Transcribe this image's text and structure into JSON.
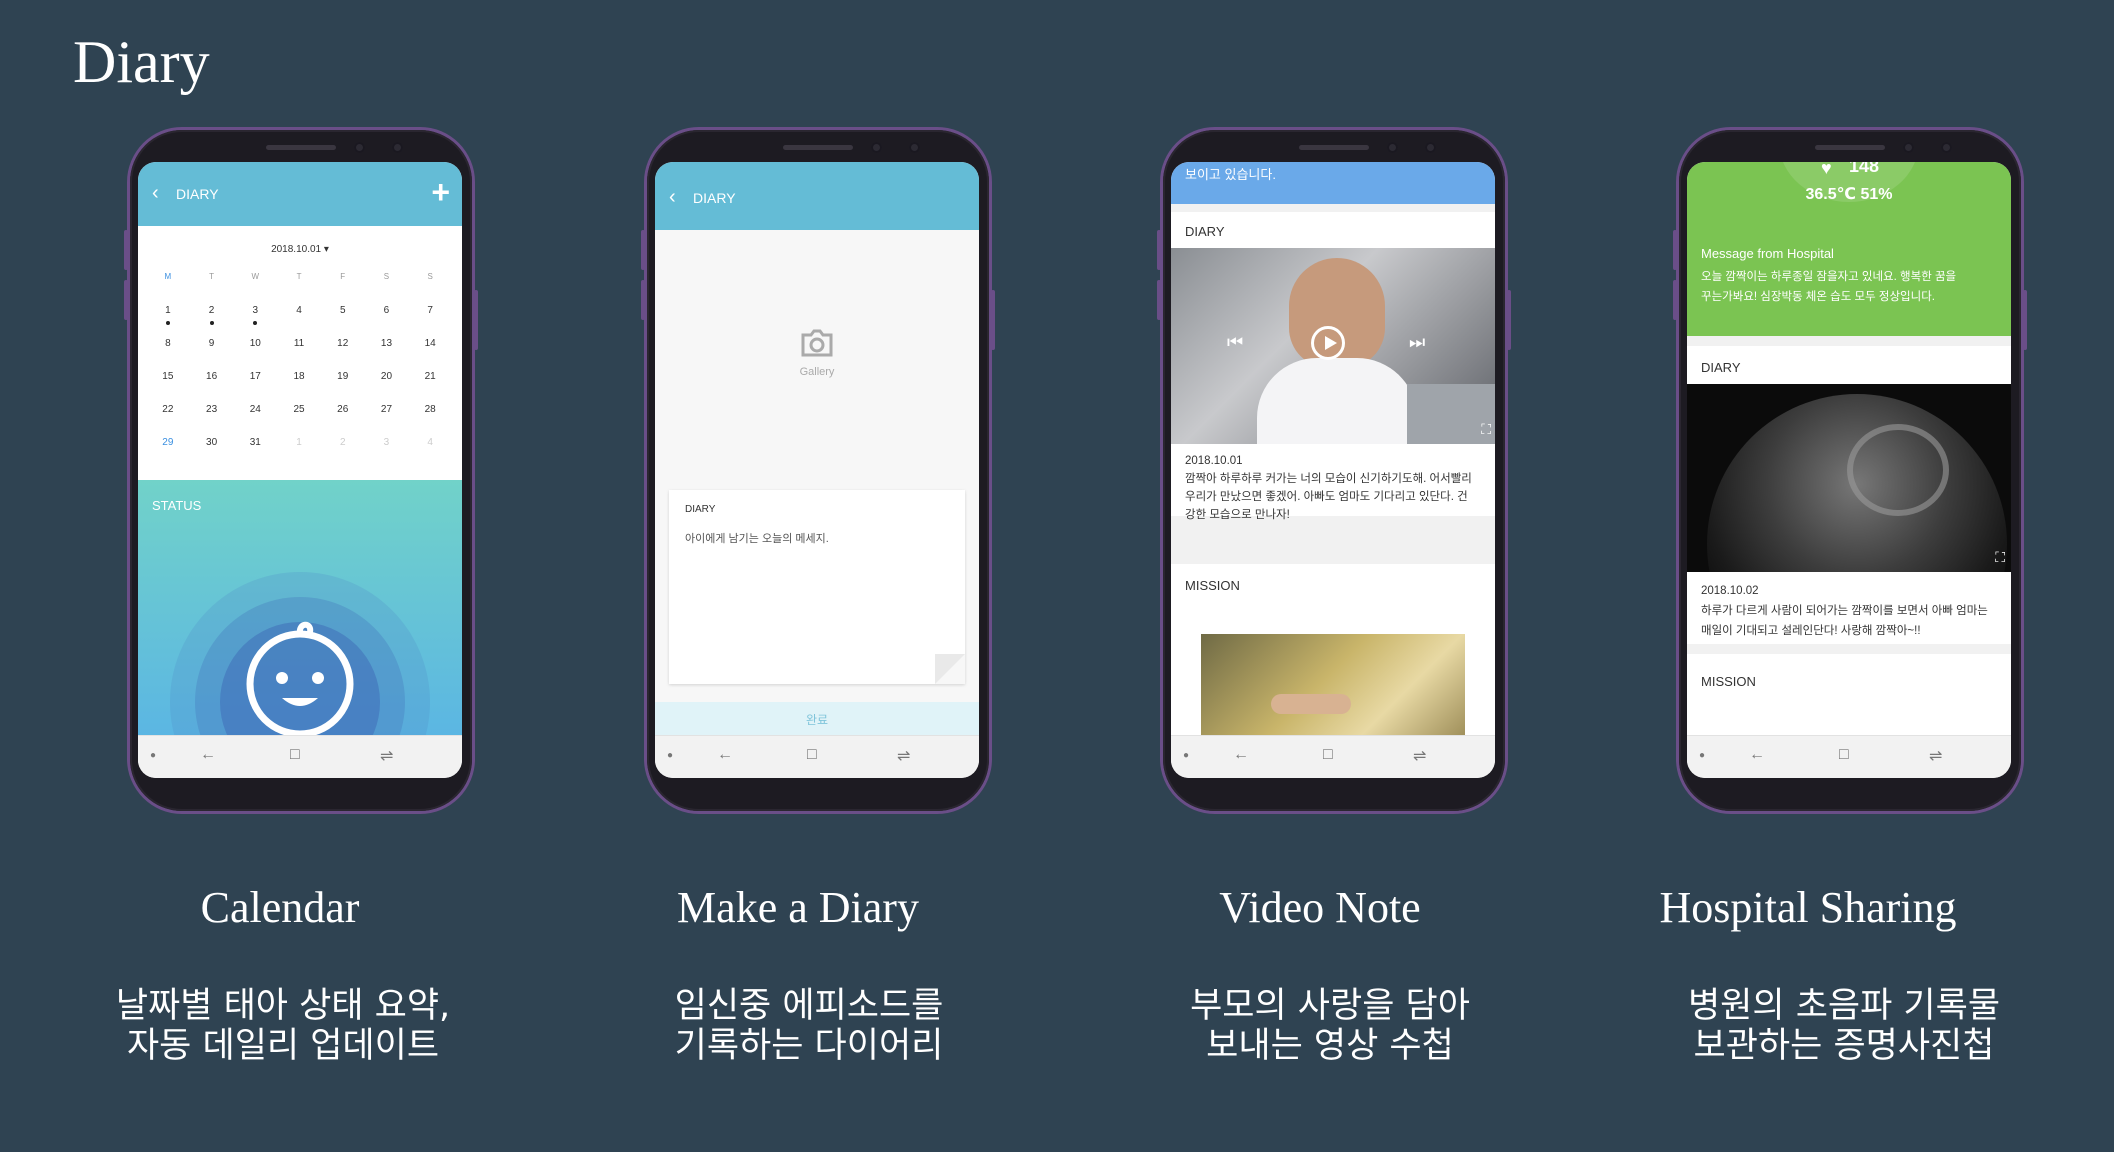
{
  "page_title": "Diary",
  "screens": [
    {
      "caption": "Calendar",
      "desc_line1": "날짜별 태아 상태 요약,",
      "desc_line2": "자동 데일리 업데이트",
      "appbar_title": "DIARY",
      "month": "2018.10.01 ▾",
      "weekdays": [
        "M",
        "T",
        "W",
        "T",
        "F",
        "S",
        "S"
      ],
      "weeks": [
        [
          "1",
          "2",
          "3",
          "4",
          "5",
          "6",
          "7"
        ],
        [
          "8",
          "9",
          "10",
          "11",
          "12",
          "13",
          "14"
        ],
        [
          "15",
          "16",
          "17",
          "18",
          "19",
          "20",
          "21"
        ],
        [
          "22",
          "23",
          "24",
          "25",
          "26",
          "27",
          "28"
        ],
        [
          "29",
          "30",
          "31",
          "1",
          "2",
          "3",
          "4"
        ]
      ],
      "status_label": "STATUS"
    },
    {
      "caption": "Make a Diary",
      "desc_line1": "임신중 에피소드를",
      "desc_line2": "기록하는 다이어리",
      "appbar_title": "DIARY",
      "gallery_label": "Gallery",
      "diary_label": "DIARY",
      "diary_placeholder": "아이에게 남기는 오늘의 메세지.",
      "done_label": "완료"
    },
    {
      "caption": "Video Note",
      "desc_line1": "부모의 사랑을 담아",
      "desc_line2": "보내는 영상 수첩",
      "top_text": "보이고 있습니다.",
      "diary_label": "DIARY",
      "date": "2018.10.01",
      "note_l1": "깜짝아 하루하루 커가는 너의 모습이 신기하기도해. 어서빨리",
      "note_l2": "우리가 만났으면 좋겠어. 아빠도 엄마도 기다리고 있단다. 건",
      "note_l3": "강한 모습으로 만나자!",
      "mission_label": "MISSION"
    },
    {
      "caption": "Hospital Sharing",
      "desc_line1": "병원의 초음파 기록물",
      "desc_line2": "보관하는 증명사진첩",
      "heart_rate": "148",
      "temp_humidity": "36.5℃  51%",
      "msg_title": "Message from Hospital",
      "msg_l1": "오늘 깜짝이는 하루종일 잠을자고 있네요. 행복한 꿈을",
      "msg_l2": "꾸는가봐요! 심장박동 체온 습도 모두 정상입니다.",
      "diary_label": "DIARY",
      "date": "2018.10.02",
      "note_l1": "하루가 다르게 사람이 되어가는 깜짝이를 보면서 아빠 엄마는",
      "note_l2": "매일이 기대되고 설레인단다!  사랑해 깜짝아~!!",
      "mission_label": "MISSION"
    }
  ]
}
